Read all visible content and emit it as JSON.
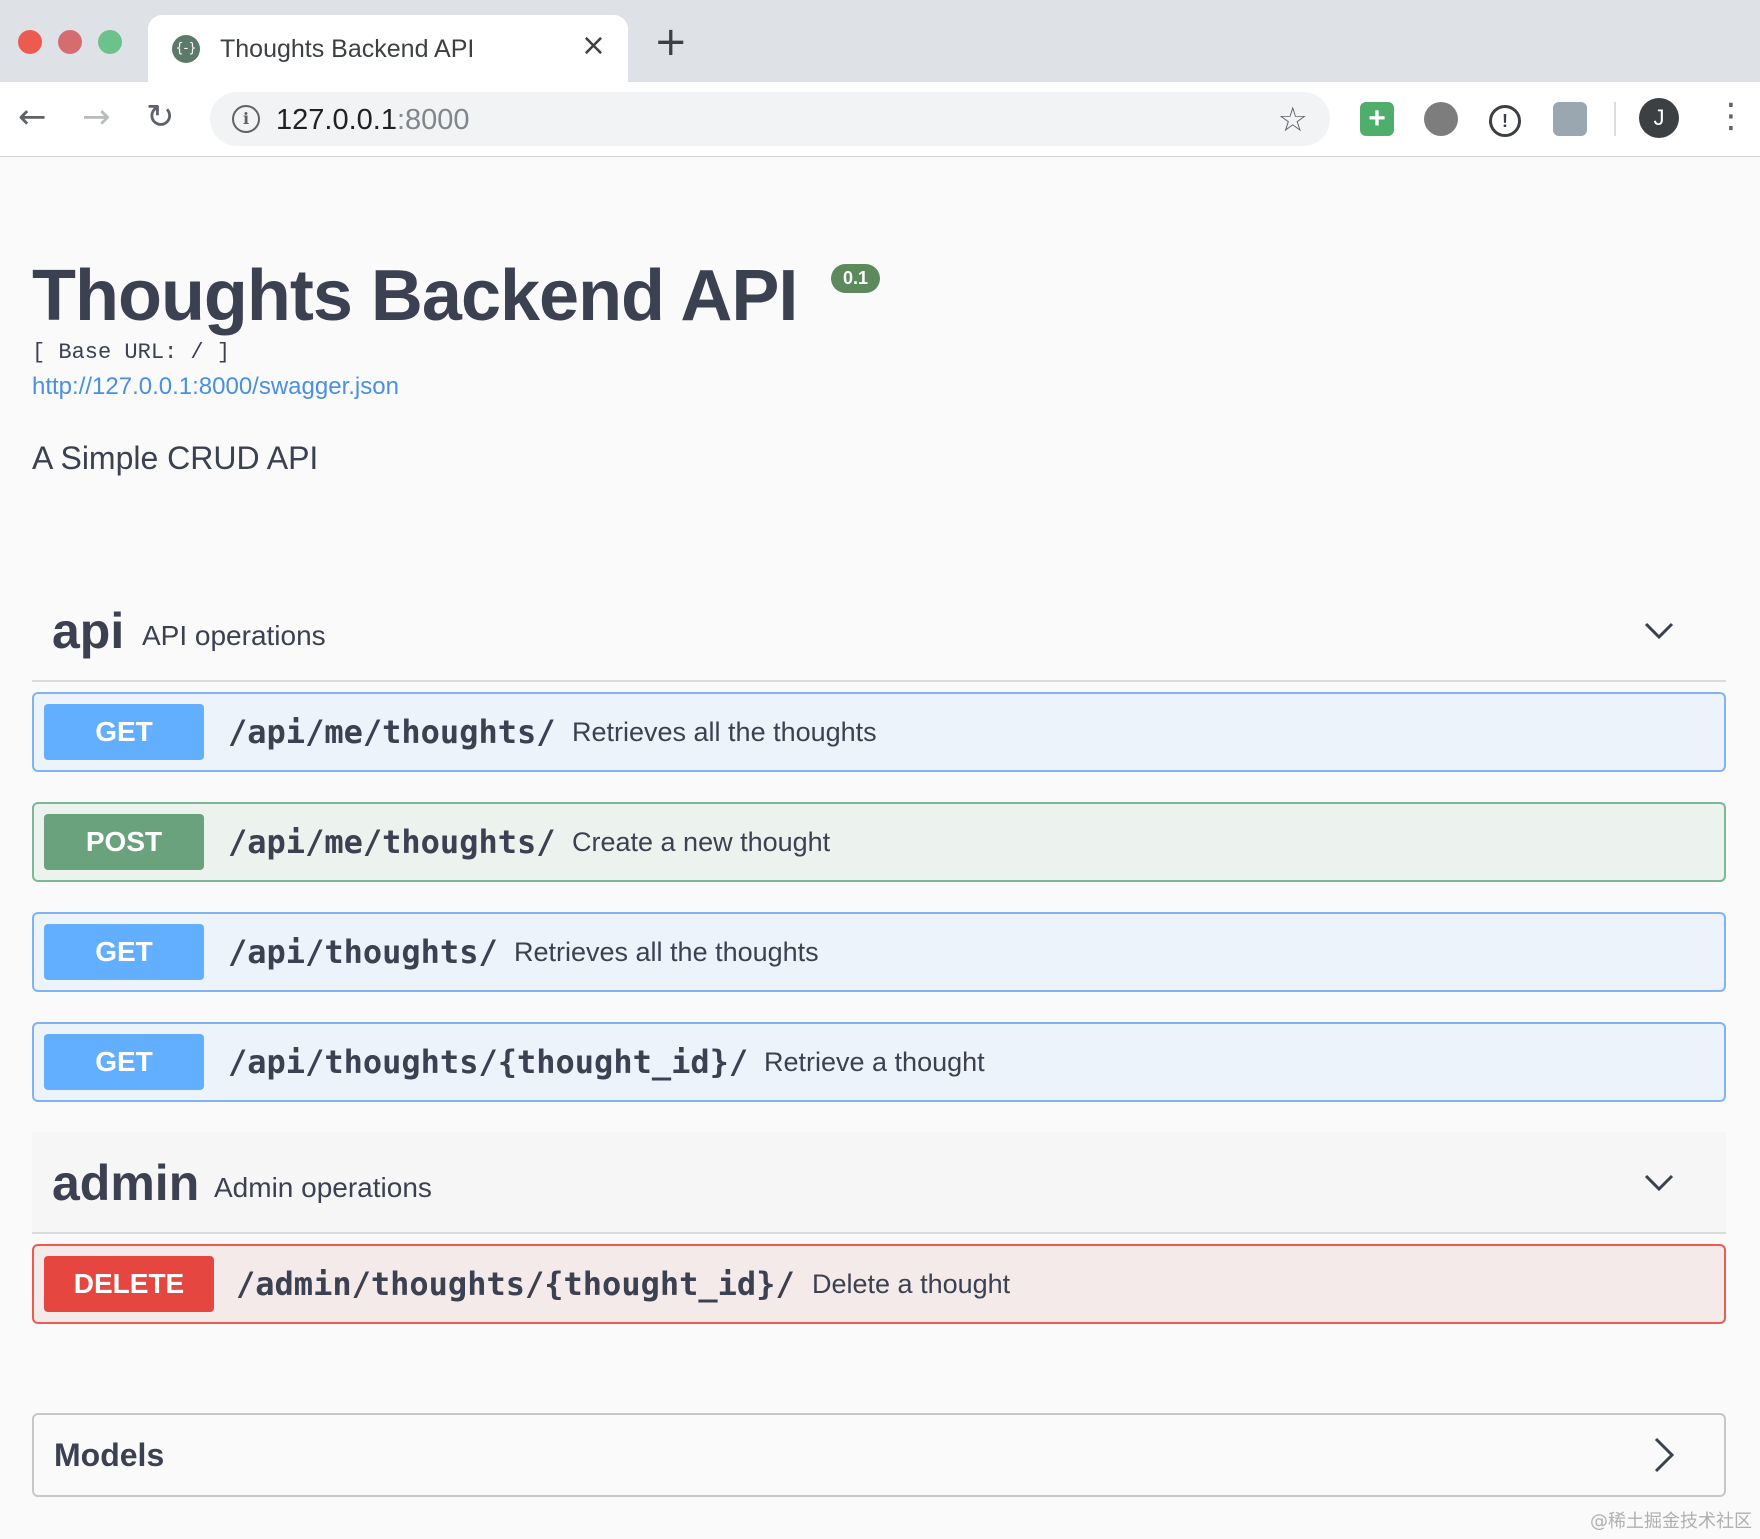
{
  "browser": {
    "tab_title": "Thoughts Backend API",
    "url_host": "127.0.0.1",
    "url_port": ":8000",
    "avatar_letter": "J",
    "favicon": "{-}",
    "icons": {
      "close": "×",
      "new_tab": "+",
      "back": "←",
      "forward": "→",
      "reload": "↻",
      "info": "i",
      "star": "☆",
      "ext_add": "+",
      "ext_info": "!",
      "menu": "⋮"
    }
  },
  "page": {
    "title": "Thoughts Backend API",
    "version": "0.1",
    "base_url": "[ Base URL: / ]",
    "spec_link": "http://127.0.0.1:8000/swagger.json",
    "description": "A Simple CRUD API"
  },
  "tags": [
    {
      "name": "api",
      "description": "API operations",
      "operations": [
        {
          "method": "GET",
          "path": "/api/me/thoughts/",
          "summary": "Retrieves all the thoughts"
        },
        {
          "method": "POST",
          "path": "/api/me/thoughts/",
          "summary": "Create a new thought"
        },
        {
          "method": "GET",
          "path": "/api/thoughts/",
          "summary": "Retrieves all the thoughts"
        },
        {
          "method": "GET",
          "path": "/api/thoughts/{thought_id}/",
          "summary": "Retrieve a thought"
        }
      ]
    },
    {
      "name": "admin",
      "description": "Admin operations",
      "operations": [
        {
          "method": "DELETE",
          "path": "/admin/thoughts/{thought_id}/",
          "summary": "Delete a thought"
        }
      ]
    }
  ],
  "models": {
    "title": "Models"
  },
  "watermark": "@稀土掘金技术社区",
  "colors": {
    "get": "#61affe",
    "post": "#6aa27d",
    "delete": "#e5463f",
    "link": "#4990e2"
  }
}
